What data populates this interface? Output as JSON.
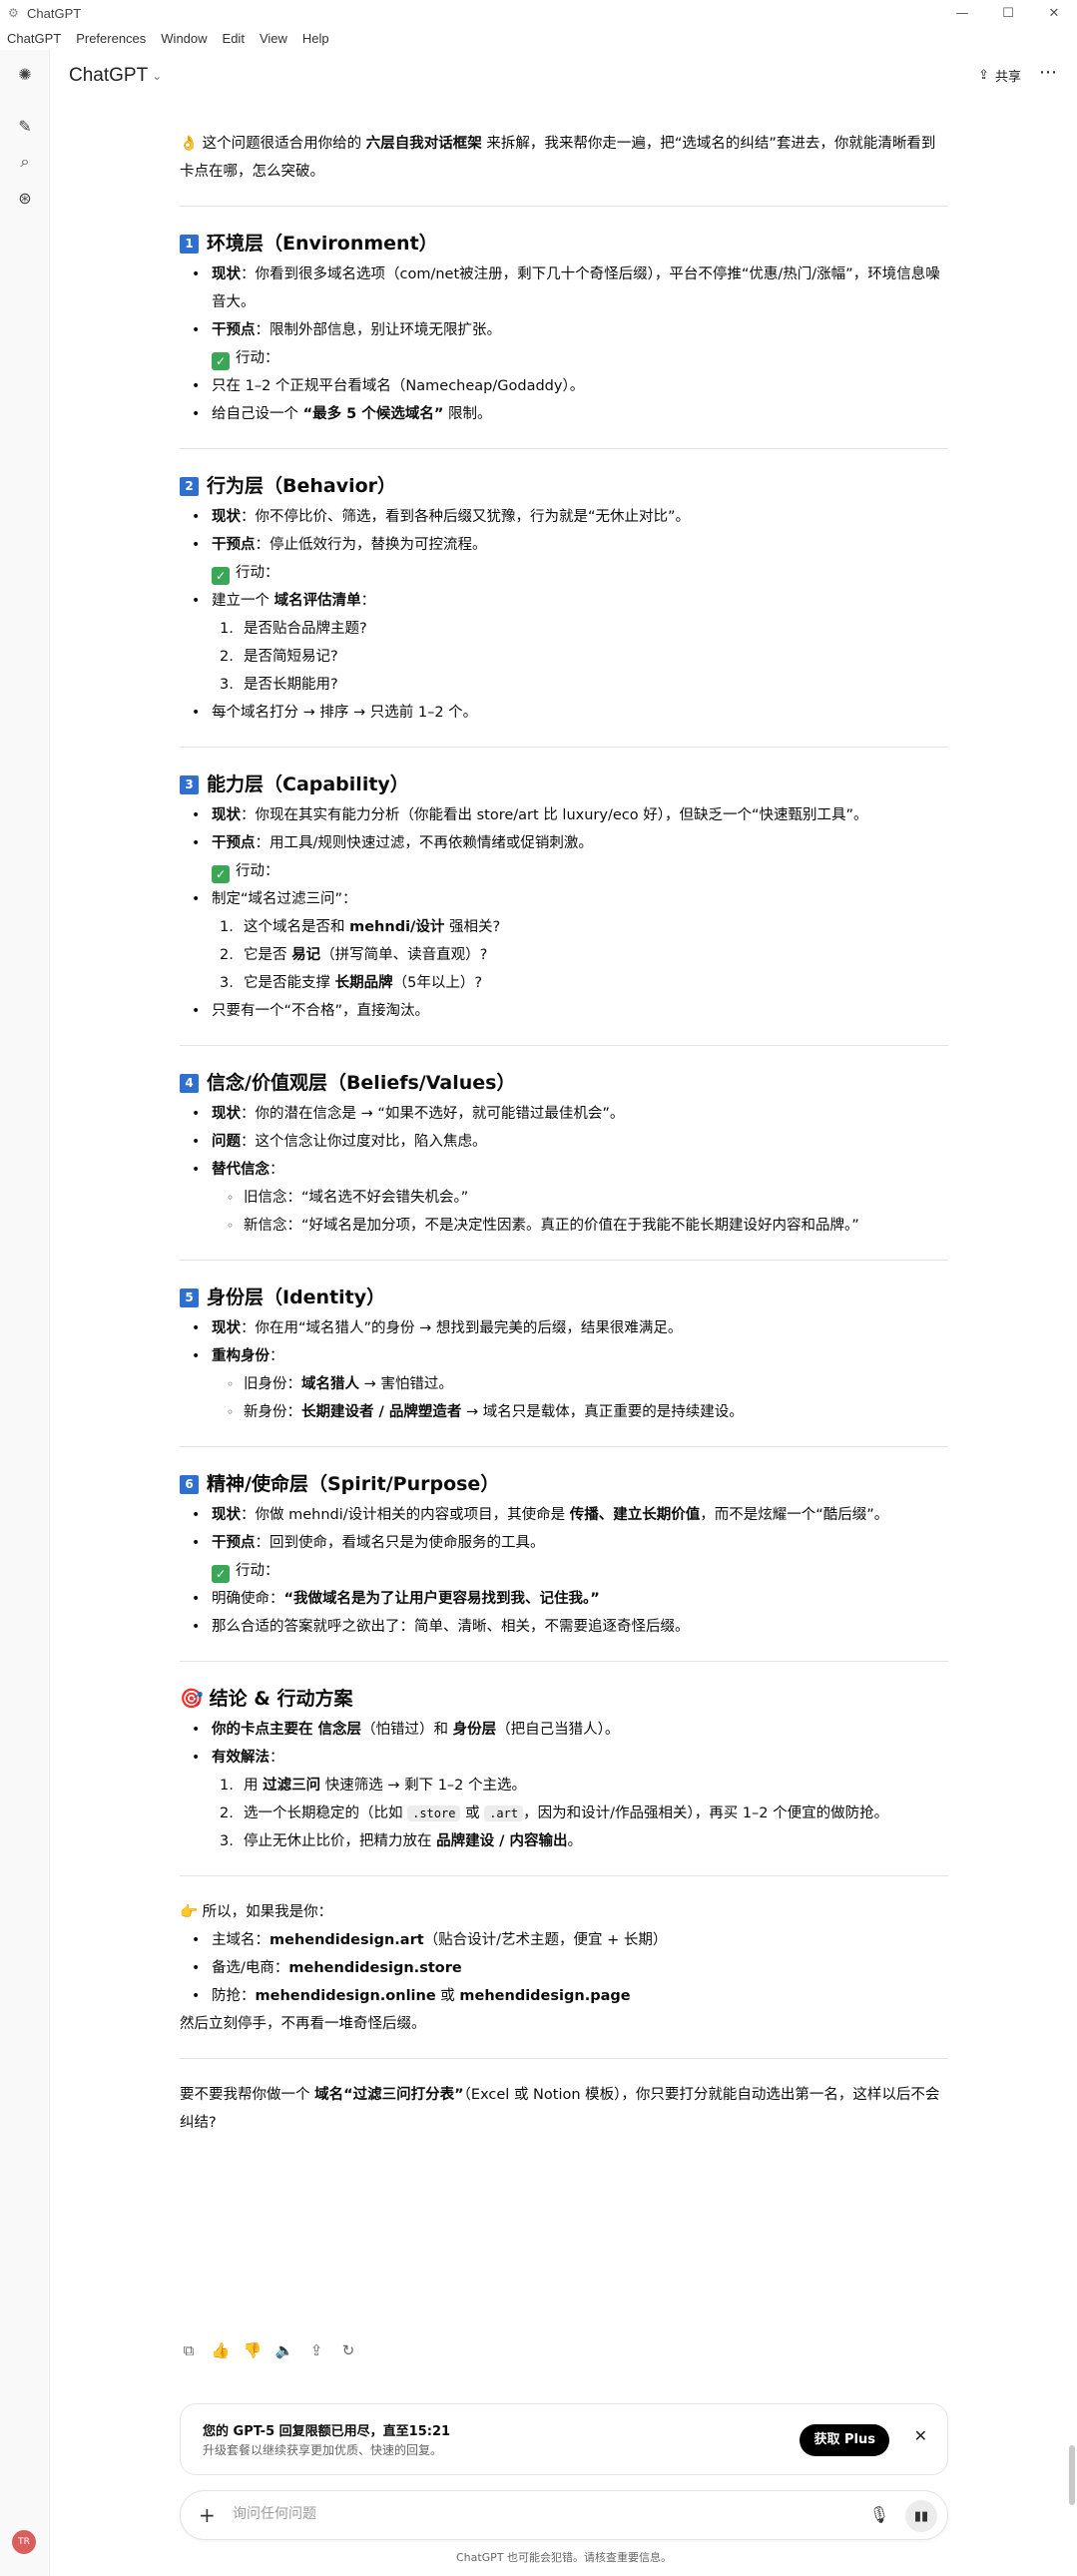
{
  "window": {
    "title": "ChatGPT",
    "minimize": "—",
    "maximize": "☐",
    "close": "✕"
  },
  "menu": [
    "ChatGPT",
    "Preferences",
    "Window",
    "Edit",
    "View",
    "Help"
  ],
  "header": {
    "model": "ChatGPT",
    "share": "共享"
  },
  "intro": {
    "emoji": "👌",
    "pre": "这个问题很适合用你给的 ",
    "bold": "六层自我对话框架",
    "post": " 来拆解，我来帮你走一遍，把“选域名的纠结”套进去，你就能清晰看到卡点在哪，怎么突破。"
  },
  "sections": [
    {
      "num": "1",
      "title": "环境层（Environment）",
      "items": [
        {
          "b": "现状",
          "t": "：你看到很多域名选项（com/net被注册，剩下几十个奇怪后缀），平台不停推“优惠/热门/涨幅”，环境信息噪音大。"
        },
        {
          "b": "干预点",
          "t": "：限制外部信息，别让环境无限扩张。"
        }
      ],
      "action": "行动：",
      "after": [
        {
          "t": "只在 1–2 个正规平台看域名（Namecheap/Godaddy）。"
        },
        {
          "pre": "给自己设一个 ",
          "b": "“最多 5 个候选域名”",
          "t": " 限制。"
        }
      ]
    },
    {
      "num": "2",
      "title": "行为层（Behavior）",
      "items": [
        {
          "b": "现状",
          "t": "：你不停比价、筛选，看到各种后缀又犹豫，行为就是“无休止对比”。"
        },
        {
          "b": "干预点",
          "t": "：停止低效行为，替换为可控流程。"
        }
      ],
      "action": "行动：",
      "after_pre": "建立一个 ",
      "after_bold": "域名评估清单",
      "after_post": "：",
      "list": [
        "是否贴合品牌主题?",
        "是否简短易记?",
        "是否长期能用?"
      ],
      "tail": "每个域名打分 → 排序 → 只选前 1–2 个。"
    },
    {
      "num": "3",
      "title": "能力层（Capability）",
      "items": [
        {
          "b": "现状",
          "t": "：你现在其实有能力分析（你能看出 store/art 比 luxury/eco 好），但缺乏一个“快速甄别工具”。"
        },
        {
          "b": "干预点",
          "t": "：用工具/规则快速过滤，不再依赖情绪或促销刺激。"
        }
      ],
      "action": "行动：",
      "after_pre": "制定“域名过滤三问”：",
      "list3": [
        {
          "pre": "这个域名是否和 ",
          "b": "mehndi/设计",
          "post": " 强相关?"
        },
        {
          "pre": "它是否 ",
          "b": "易记",
          "post": "（拼写简单、读音直观）?"
        },
        {
          "pre": "它是否能支撑 ",
          "b": "长期品牌",
          "post": "（5年以上）?"
        }
      ],
      "tail": "只要有一个“不合格”，直接淘汰。"
    },
    {
      "num": "4",
      "title": "信念/价值观层（Beliefs/Values）",
      "items": [
        {
          "b": "现状",
          "t": "：你的潜在信念是 → “如果不选好，就可能错过最佳机会”。"
        },
        {
          "b": "问题",
          "t": "：这个信念让你过度对比，陷入焦虑。"
        },
        {
          "b": "替代信念",
          "t": "："
        }
      ],
      "sub": [
        "旧信念：“域名选不好会错失机会。”",
        "新信念：“好域名是加分项，不是决定性因素。真正的价值在于我能不能长期建设好内容和品牌。”"
      ]
    },
    {
      "num": "5",
      "title": "身份层（Identity）",
      "items": [
        {
          "b": "现状",
          "t": "：你在用“域名猎人”的身份 → 想找到最完美的后缀，结果很难满足。"
        },
        {
          "b": "重构身份",
          "t": "："
        }
      ],
      "sub2": [
        {
          "pre": "旧身份：",
          "b": "域名猎人",
          "post": " → 害怕错过。"
        },
        {
          "pre": "新身份：",
          "b": "长期建设者 / 品牌塑造者",
          "post": " → 域名只是载体，真正重要的是持续建设。"
        }
      ]
    },
    {
      "num": "6",
      "title": "精神/使命层（Spirit/Purpose）",
      "items": [
        {
          "b": "现状",
          "pre2": "：你做 mehndi/设计相关的内容或项目，其使命是 ",
          "b2": "传播、建立长期价值",
          "t": "，而不是炫耀一个“酷后缀”。"
        },
        {
          "b": "干预点",
          "t": "：回到使命，看域名只是为使命服务的工具。"
        }
      ],
      "action": "行动：",
      "after": [
        {
          "pre": "明确使命：",
          "b": "“我做域名是为了让用户更容易找到我、记住我。”",
          "t": ""
        },
        {
          "t": "那么合适的答案就呼之欲出了：简单、清晰、相关，不需要追逐奇怪后缀。"
        }
      ]
    }
  ],
  "conclusion": {
    "emoji": "🎯",
    "title": "结论 & 行动方案",
    "line1": {
      "b1": "你的卡点主要在 信念层",
      "m": "（怕错过）和 ",
      "b2": "身份层",
      "post": "（把自己当猎人）。"
    },
    "line2": "有效解法",
    "steps": [
      {
        "pre": "用 ",
        "b": "过滤三问",
        "post": " 快速筛选 → 剩下 1–2 个主选。"
      },
      {
        "pre": "选一个长期稳定的（比如 ",
        "c1": ".store",
        "m": " 或 ",
        "c2": ".art",
        "post": "，因为和设计/作品强相关），再买 1–2 个便宜的做防抢。"
      },
      {
        "pre": "停止无休止比价，把精力放在 ",
        "b": "品牌建设 / 内容输出",
        "post": "。"
      }
    ]
  },
  "ifme": {
    "emoji": "👉",
    "lead": "所以，如果我是你：",
    "main_l": "主域名：",
    "main_b": "mehendidesign.art",
    "main_t": "（贴合设计/艺术主题，便宜 + 长期）",
    "alt_l": "备选/电商：",
    "alt_b": "mehendidesign.store",
    "def_l": "防抢：",
    "def_b1": "mehendidesign.online",
    "def_m": " 或 ",
    "def_b2": "mehendidesign.page",
    "end": "然后立刻停手，不再看一堆奇怪后缀。"
  },
  "question": {
    "pre": "要不要我帮你做一个 ",
    "b": "域名“过滤三问打分表”",
    "post": "（Excel 或 Notion 模板），你只要打分就能自动选出第一名，这样以后不会纠结?"
  },
  "limit": {
    "title": "您的 GPT-5 回复限额已用尽，直至15:21",
    "sub": "升级套餐以继续获享更加优质、快速的回复。",
    "button": "获取 Plus"
  },
  "input": {
    "placeholder": "询问任何问题"
  },
  "footer": "ChatGPT 也可能会犯错。请核查重要信息。",
  "user_initials": "TR"
}
